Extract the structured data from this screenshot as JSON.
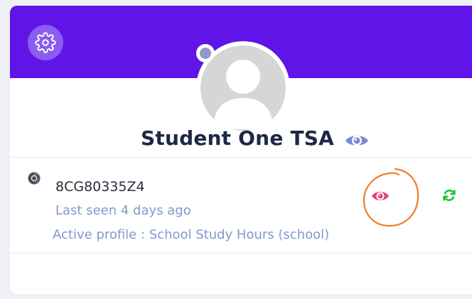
{
  "student": {
    "name": "Student One TSA",
    "status_color": "#8d99c9"
  },
  "device": {
    "id": "8CG80335Z4",
    "browser_icon": "chrome-icon",
    "last_seen": "Last seen 4 days ago",
    "active_profile": "Active profile : School Study Hours (school)"
  },
  "actions": {
    "settings_icon": "gear-icon",
    "view_student_icon": "eye-icon",
    "view_device_icon": "eye-icon",
    "refresh_icon": "refresh-icon"
  },
  "colors": {
    "header": "#6114e8",
    "settings_button": "#8a5cf0",
    "student_eye": "#7b86d6",
    "device_eye": "#e5407b",
    "refresh": "#1ec63a",
    "annotation_circle": "#ef7d2d",
    "muted_text": "#8497d0"
  }
}
